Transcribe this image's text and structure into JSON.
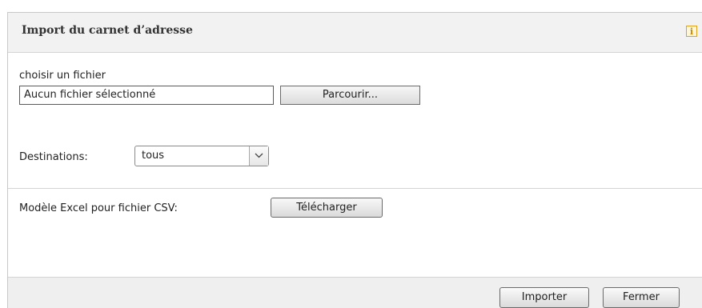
{
  "dialog": {
    "title": "Import du carnet d’adresse",
    "info_icon": "info-icon"
  },
  "file": {
    "label": "choisir un fichier",
    "value": "Aucun fichier sélectionné",
    "browse_label": "Parcourir..."
  },
  "destinations": {
    "label": "Destinations:",
    "selected": "tous",
    "arrow_icon": "chevron-down-icon"
  },
  "excel": {
    "label": "Modèle Excel pour fichier CSV:",
    "download_label": "Télécharger"
  },
  "footer": {
    "import_label": "Importer",
    "close_label": "Fermer"
  },
  "colors": {
    "header_bg": "#f2f2f2",
    "footer_bg": "#efefef",
    "info_accent": "#e0a020"
  }
}
